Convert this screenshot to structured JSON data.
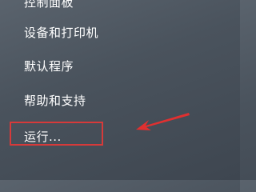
{
  "menu": {
    "items": [
      {
        "label": "控制面板"
      },
      {
        "label": "设备和打印机"
      },
      {
        "label": "默认程序"
      },
      {
        "label": "帮助和支持"
      },
      {
        "label": "运行..."
      }
    ]
  },
  "annotation": {
    "highlight_color": "#d63a3a",
    "arrow_color": "#e03030",
    "arrow_icon": "red-arrow-icon"
  }
}
